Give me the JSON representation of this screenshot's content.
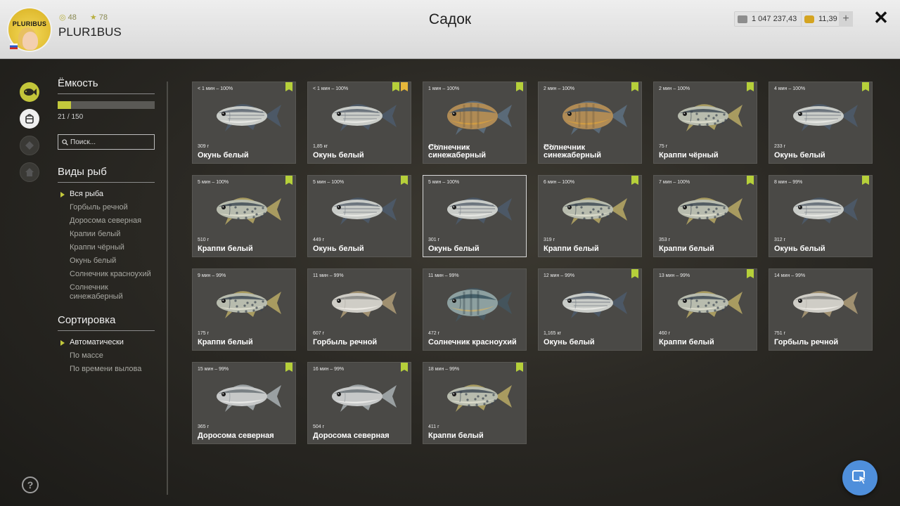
{
  "header": {
    "title": "Садок",
    "username": "PLUR1BUS",
    "avatar_text": "PLURIBUS",
    "level": "48",
    "rating": "78",
    "silver": "1 047 237,43",
    "gold": "11,39",
    "plus_label": "+",
    "close_label": "✕"
  },
  "sidebar": {
    "capacity_title": "Ёмкость",
    "capacity_used": 21,
    "capacity_total": 150,
    "capacity_text": "21 / 150",
    "search_placeholder": "Поиск...",
    "species_title": "Виды рыб",
    "species": [
      "Вся рыба",
      "Горбыль речной",
      "Доросома северная",
      "Крапии белый",
      "Краппи чёрный",
      "Окунь белый",
      "Солнечник красноухий",
      "Солнечник синежаберный"
    ],
    "sort_title": "Сортировка",
    "sort_options": [
      "Автоматически",
      "По массе",
      "По времени вылова"
    ],
    "help_label": "?"
  },
  "fish": [
    {
      "time": "< 1 мин – 100%",
      "weight": "309 г",
      "name": "Окунь белый",
      "type": "bass",
      "badges": [
        "check"
      ]
    },
    {
      "time": "< 1 мин – 100%",
      "weight": "1,85 кг",
      "name": "Окунь белый",
      "type": "bass",
      "badges": [
        "check",
        "star"
      ]
    },
    {
      "time": "1 мин – 100%",
      "weight": "476 г",
      "name": "Солнечник синежаберный",
      "type": "sunfish",
      "badges": [
        "check"
      ]
    },
    {
      "time": "2 мин – 100%",
      "weight": "343 г",
      "name": "Солнечник синежаберный",
      "type": "sunfish",
      "badges": [
        "check"
      ]
    },
    {
      "time": "2 мин – 100%",
      "weight": "75 г",
      "name": "Краппи чёрный",
      "type": "crappie",
      "badges": [
        "check"
      ]
    },
    {
      "time": "4 мин – 100%",
      "weight": "233 г",
      "name": "Окунь белый",
      "type": "bass",
      "badges": [
        "check"
      ]
    },
    {
      "time": "5 мин – 100%",
      "weight": "510 г",
      "name": "Краппи белый",
      "type": "crappie",
      "badges": [
        "check"
      ]
    },
    {
      "time": "5 мин – 100%",
      "weight": "449 г",
      "name": "Окунь белый",
      "type": "bass",
      "badges": [
        "check"
      ]
    },
    {
      "time": "5 мин – 100%",
      "weight": "301 г",
      "name": "Окунь белый",
      "type": "bass",
      "badges": [],
      "highlight": true
    },
    {
      "time": "6 мин – 100%",
      "weight": "319 г",
      "name": "Краппи белый",
      "type": "crappie",
      "badges": [
        "check"
      ]
    },
    {
      "time": "7 мин – 100%",
      "weight": "353 г",
      "name": "Краппи белый",
      "type": "crappie",
      "badges": [
        "check"
      ]
    },
    {
      "time": "8 мин – 99%",
      "weight": "312 г",
      "name": "Окунь белый",
      "type": "bass",
      "badges": [
        "check"
      ]
    },
    {
      "time": "9 мин – 99%",
      "weight": "175 г",
      "name": "Краппи белый",
      "type": "crappie",
      "badges": []
    },
    {
      "time": "11 мин – 99%",
      "weight": "607 г",
      "name": "Горбыль речной",
      "type": "drum",
      "badges": []
    },
    {
      "time": "11 мин – 99%",
      "weight": "472 г",
      "name": "Солнечник красноухий",
      "type": "redear",
      "badges": []
    },
    {
      "time": "12 мин – 99%",
      "weight": "1,165 кг",
      "name": "Окунь белый",
      "type": "bass",
      "badges": [
        "check"
      ]
    },
    {
      "time": "13 мин – 99%",
      "weight": "460 г",
      "name": "Краппи белый",
      "type": "crappie",
      "badges": [
        "check"
      ]
    },
    {
      "time": "14 мин – 99%",
      "weight": "751 г",
      "name": "Горбыль речной",
      "type": "drum",
      "badges": []
    },
    {
      "time": "15 мин – 99%",
      "weight": "365 г",
      "name": "Доросома северная",
      "type": "shad",
      "badges": [
        "check"
      ]
    },
    {
      "time": "16 мин – 99%",
      "weight": "504 г",
      "name": "Доросома северная",
      "type": "shad",
      "badges": [
        "check"
      ]
    },
    {
      "time": "18 мин – 99%",
      "weight": "411 г",
      "name": "Краппи белый",
      "type": "crappie",
      "badges": [
        "check"
      ]
    }
  ],
  "colors": {
    "accent": "#c2c83c",
    "badge_check": "#b6d03a",
    "badge_star": "#e7b73a",
    "card_bg": "#4a4946",
    "cursor_button": "#4f8fdb"
  }
}
